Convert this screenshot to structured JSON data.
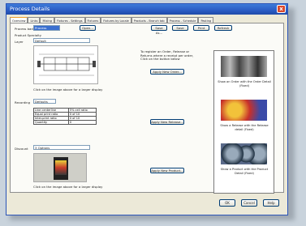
{
  "window": {
    "title": "Process Details",
    "close": "x"
  },
  "tabs": [
    "Overview",
    "Links",
    "Mixing",
    "Fixtures - Settings",
    "Fixtures",
    "Fixtures by Locale",
    "Products - Branch tab",
    "Process - Schedule",
    "Pasting"
  ],
  "header": {
    "product_badge_label": "Process badge",
    "product_badge_value": "Process",
    "open_label": "Open...",
    "save_as_label": "Save As...",
    "save_label": "Save",
    "print_label": "Print",
    "refresh_label": "Refresh"
  },
  "section_label": "Product Specialty",
  "drawing": {
    "label": "Layer",
    "value": "Default",
    "caption": "Click on the image above for a larger display"
  },
  "rate": {
    "label": "Recording",
    "value": "Defaults",
    "rows": [
      [
        "Line centerline",
        "5% cell ratio"
      ],
      [
        "Equal print ratio",
        "0 of 10"
      ],
      [
        "Inter-print ratio",
        "0 of 10"
      ],
      [
        "Quantity",
        "0"
      ]
    ]
  },
  "picture": {
    "label": "Discount",
    "value": "3 Options",
    "caption": "Click on the image above for a larger display"
  },
  "middle": {
    "instructions": "To register an Order, Release or Returns where a receipt per order, Click on the button below",
    "apply_order": "Apply New Order...",
    "apply_release": "Apply New Release...",
    "apply_product": "Apply New Product..."
  },
  "right_panel": {
    "caption1": "Show an Order with the Order Detail (Fixed)",
    "caption2": "Show a Release with the Release detail (Fixed)",
    "caption3": "Show a Product with the Product Detail (Fixed)"
  },
  "footer": {
    "ok": "OK",
    "cancel": "Cancel",
    "help": "Help"
  },
  "colors": {
    "title_bar": "#2a5cc4",
    "panel": "#fbfbf7",
    "window": "#ece9d8"
  }
}
